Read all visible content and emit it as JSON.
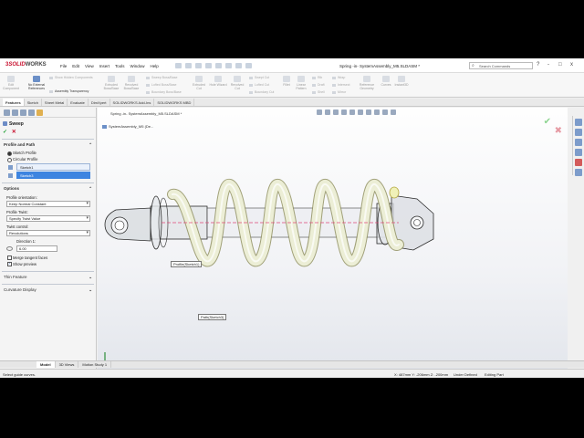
{
  "titlebar": {
    "logo_main": "SOLID",
    "logo_sub": "WORKS",
    "menu": [
      "File",
      "Edit",
      "View",
      "Insert",
      "Tools",
      "Window",
      "Help"
    ],
    "document_title": "Spring -in- SystemAssembly_M5.SLDASM *",
    "search_placeholder": "Search Commands",
    "window_controls": [
      "?",
      "-",
      "□",
      "x"
    ]
  },
  "ribbon": {
    "large_buttons": [
      {
        "label": "Edit Component",
        "active": false
      },
      {
        "label": "No External References",
        "active": true
      },
      {
        "label": "Extruded Boss/Base",
        "active": false
      },
      {
        "label": "Revolved Boss/Base",
        "active": false
      },
      {
        "label": "Extruded Cut",
        "active": false
      },
      {
        "label": "Hole Wizard",
        "active": false
      },
      {
        "label": "Revolved Cut",
        "active": false
      },
      {
        "label": "Fillet",
        "active": false
      },
      {
        "label": "Linear Pattern",
        "active": false
      },
      {
        "label": "Draft",
        "active": false
      },
      {
        "label": "Reference Geometry",
        "active": false
      },
      {
        "label": "Curves",
        "active": false
      },
      {
        "label": "Instant3D",
        "active": false
      }
    ],
    "small_buttons": [
      {
        "label": "Show Hidden Components",
        "active": false
      },
      {
        "label": "Assembly Transparency",
        "active": true
      },
      {
        "label": "Sweep Boss/Base",
        "active": false
      },
      {
        "label": "Lofted Boss/Base",
        "active": false
      },
      {
        "label": "Boundary Boss/Base",
        "active": false
      },
      {
        "label": "Swept Cut",
        "active": false
      },
      {
        "label": "Lofted Cut",
        "active": false
      },
      {
        "label": "Boundary Cut",
        "active": false
      },
      {
        "label": "Rib",
        "active": false
      },
      {
        "label": "Wrap",
        "active": false
      },
      {
        "label": "Shell",
        "active": false
      },
      {
        "label": "Intersect",
        "active": false
      },
      {
        "label": "Mirror",
        "active": false
      }
    ]
  },
  "command_tabs": [
    "Features",
    "Sketch",
    "Sheet Metal",
    "Evaluate",
    "DimXpert",
    "SOLIDWORKS Add-Ins",
    "SOLIDWORKS MBD"
  ],
  "breadcrumb": "Spring -in- SystemAssembly_M5.SLDASM *",
  "property_manager": {
    "title": "Sweep",
    "ok": "✓",
    "cancel": "✕",
    "profile_path": {
      "heading": "Profile and Path",
      "option_sketch": "Sketch Profile",
      "option_circular": "Circular Profile",
      "profile_value": "Sketch1",
      "path_value": "Sketch3"
    },
    "options": {
      "heading": "Options",
      "orientation_label": "Profile orientation:",
      "orientation_value": "Keep Normal Constant",
      "twist_label": "Profile Twist:",
      "twist_value": "Specify Twist Value",
      "twist_control_label": "Twist control:",
      "twist_control_value": "Revolutions",
      "direction_label": "Direction 1:",
      "direction_value": "6.00",
      "merge_tangent": "Merge tangent faces",
      "show_preview": "Show preview"
    },
    "thin_feature": "Thin Feature",
    "curvature_display": "Curvature Display"
  },
  "graphics": {
    "tree_item": "SystemAssembly_M5 (De...",
    "callout_profile": "Profile(Sketch1)",
    "callout_path": "Path(Sketch3)"
  },
  "bottom_tabs": [
    "Model",
    "3D Views",
    "Motion Study 1"
  ],
  "status": {
    "left": "Select guide curves.",
    "coords": "X: 487mm  Y: -206mm  Z: -200mm",
    "state": "Under Defined",
    "mode": "Editing Part"
  },
  "colors": {
    "accent": "#3d84e0",
    "brand": "#c8102e",
    "spring": "#e8ead0",
    "spring_edge": "#8c8c5a"
  }
}
